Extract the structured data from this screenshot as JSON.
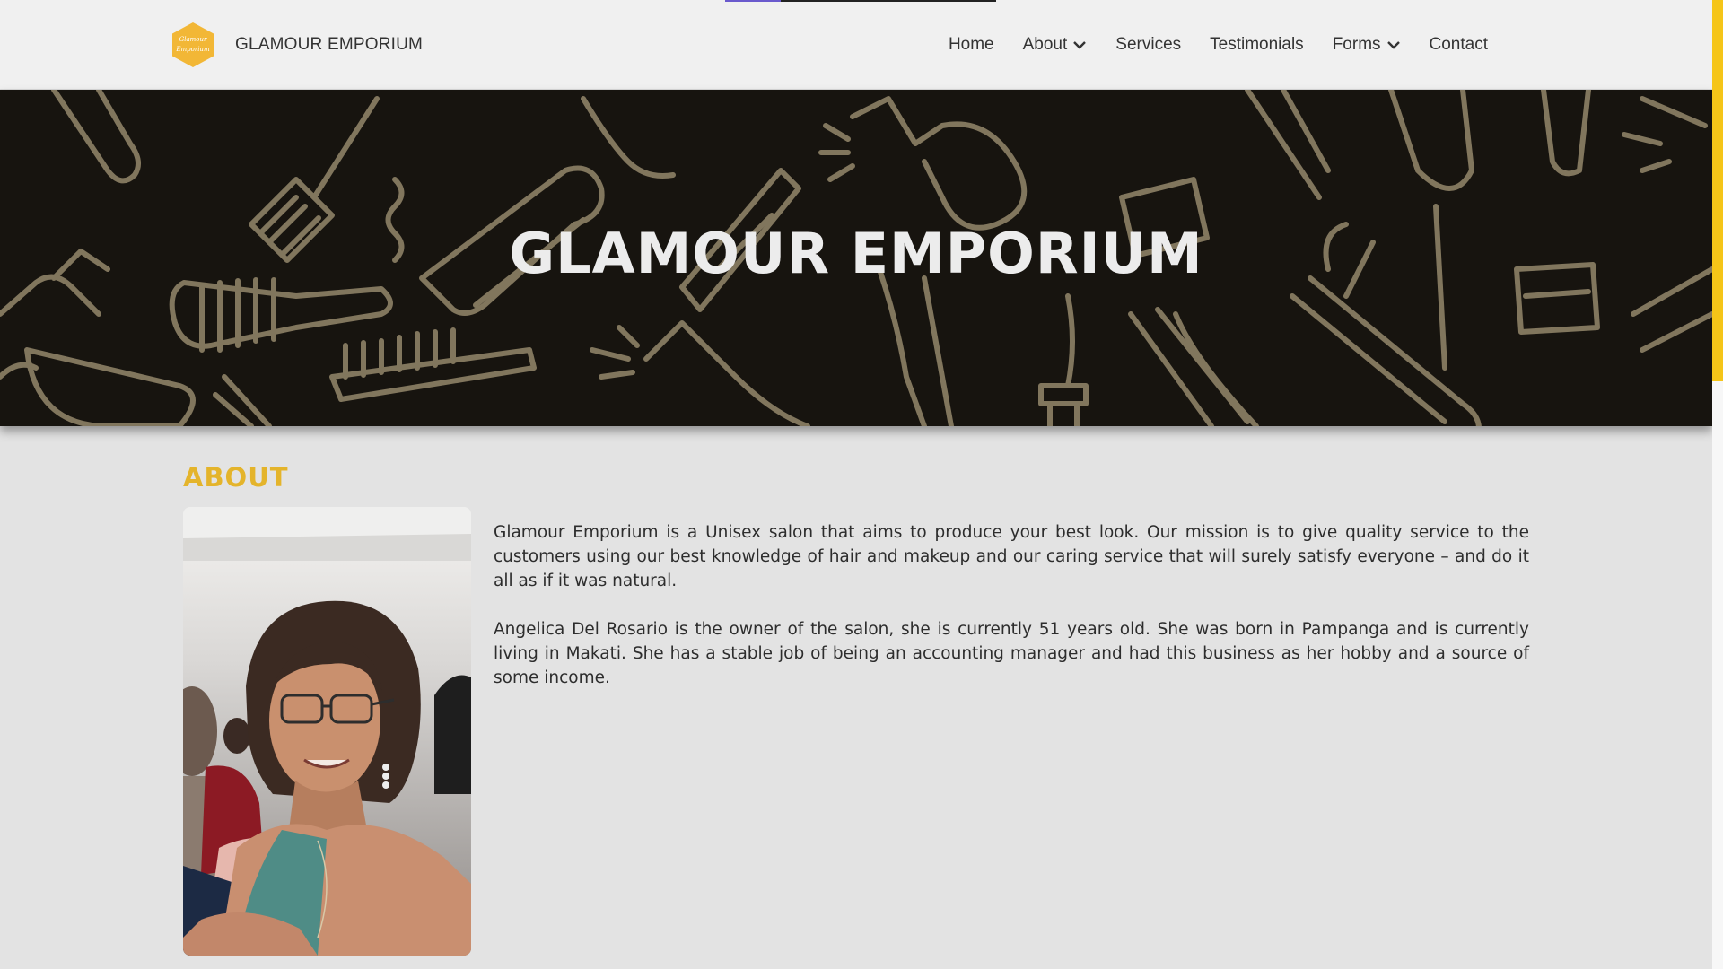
{
  "brand": {
    "name": "GLAMOUR EMPORIUM",
    "logo_text": [
      "Glamour",
      "Emporium"
    ]
  },
  "nav": {
    "items": [
      {
        "label": "Home",
        "has_dropdown": false
      },
      {
        "label": "About",
        "has_dropdown": true
      },
      {
        "label": "Services",
        "has_dropdown": false
      },
      {
        "label": "Testimonials",
        "has_dropdown": false
      },
      {
        "label": "Forms",
        "has_dropdown": true
      },
      {
        "label": "Contact",
        "has_dropdown": false
      }
    ]
  },
  "hero": {
    "title": "GLAMOUR EMPORIUM"
  },
  "about": {
    "heading": "ABOUT",
    "paragraphs": [
      "Glamour Emporium is a Unisex salon that aims to produce your best look. Our mission is to give quality service to the customers using our best knowledge of hair and makeup and our caring service that will surely satisfy everyone – and do it all as if it was natural.",
      "Angelica Del Rosario is the owner of the salon, she is currently 51 years old. She was born in Pampanga and is currently living in Makati. She has a stable job of being an accounting manager and had this business as her hobby and a source of some income."
    ]
  },
  "colors": {
    "accent": "#e4b42b",
    "scrollbar": "#f5c518",
    "hero_bg": "#17140f",
    "navbar_bg": "#f0f0f0",
    "page_bg": "#e3e3e3"
  },
  "icons": [
    "chevron-down-icon",
    "logo-hexagon-icon"
  ]
}
